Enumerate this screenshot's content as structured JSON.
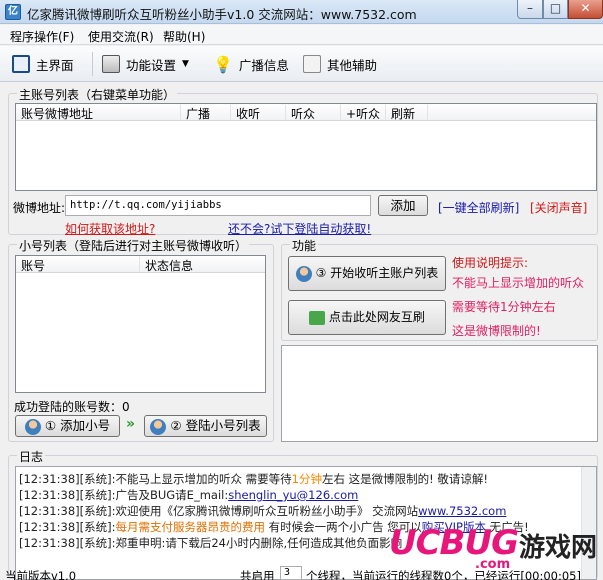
{
  "window": {
    "title": "亿家腾讯微博刷听众互听粉丝小助手v1.0    交流网站：www.7532.com",
    "min": "–",
    "max": "□",
    "close": "✕",
    "app_icon": "亿"
  },
  "menu": [
    {
      "label": "程序操作(F)"
    },
    {
      "label": "使用交流(R)"
    },
    {
      "label": "帮助(H)"
    }
  ],
  "toolbar": {
    "main": "主界面",
    "settings": "功能设置",
    "broadcast": "广播信息",
    "other": "其他辅助",
    "dropdown": "▼"
  },
  "main_group": {
    "legend": "主账号列表（右键菜单功能）",
    "columns": [
      "账号微博地址",
      "广播",
      "收听",
      "听众",
      "+听众",
      "刷新"
    ],
    "weibo_label": "微博地址:",
    "weibo_value": "http://t.qq.com/yijiabbs",
    "add_button": "添加",
    "refresh_all": "[一键全部刷新]",
    "mute": "[关闭声音]",
    "how_link": "如何获取该地址?",
    "test_link": "还不会?试下登陆自动获取!"
  },
  "sub_group": {
    "legend": "小号列表（登陆后进行对主账号微博收听）",
    "columns": [
      "账号",
      "状态信息"
    ],
    "success_label": "成功登陆的账号数：",
    "success_count": "0",
    "add_btn": "① 添加小号",
    "arrow": "»",
    "login_btn": "② 登陆小号列表"
  },
  "func_group": {
    "legend": "功能",
    "start_btn": "③ 开始收听主账户列表",
    "mutual_btn": "点击此处网友互刷",
    "tips": [
      "使用说明提示:",
      "不能马上显示增加的听众",
      "需要等待1分钟左右",
      "这是微博限制的!"
    ]
  },
  "log": {
    "legend": "日志",
    "lines": [
      {
        "prefix": "[12:31:38][系统]:不能马上显示增加的听众  需要等待",
        "hl": "1分钟",
        "suffix": "左右  这是微博限制的! 敬请谅解!"
      },
      {
        "prefix": "[12:31:38][系统]:广告及BUG请E_mail:",
        "link": "shenglin_yu@126.com",
        "suffix": ""
      },
      {
        "prefix": "[12:31:38][系统]:欢迎使用《亿家腾讯微博刷听众互听粉丝小助手》 交流网站",
        "link": "www.7532.com",
        "suffix": ""
      },
      {
        "prefix": "[12:31:38][系统]:",
        "red": "每月需支付服务器昂贵的费用",
        "mid": "  有时候会一两个小广告  您可以",
        "link": "购买VIP版本",
        "suffix": "  无广告!"
      },
      {
        "prefix": "[12:31:38][系统]:郑重申明:请下载后24小时内删除,任何造成其他负面影响",
        "suffix": ""
      }
    ]
  },
  "status": {
    "version": "当前版本v1.0",
    "threads_label": "共启用",
    "threads": "3",
    "threads_unit": "个线程，当前运行的线程数",
    "running": "0",
    "running_unit": "个，已经运行[00:00:05]"
  },
  "watermark": {
    "brand": "UCBUG",
    "tagline": "游戏网",
    "domain": ".com"
  },
  "colors": {
    "link": "#1a1aa8",
    "warning": "#d01818",
    "tip": "#e02060",
    "highlight": "#ff8800"
  }
}
